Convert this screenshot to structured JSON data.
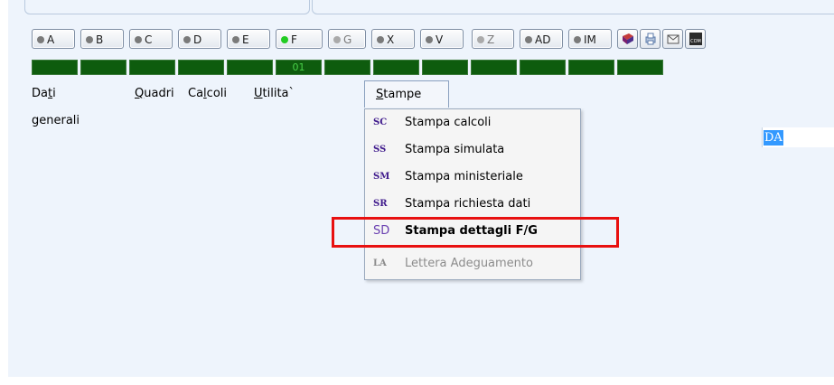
{
  "toolbar": {
    "buttons": [
      {
        "label": "A",
        "dot": "gray"
      },
      {
        "label": "B",
        "dot": "gray"
      },
      {
        "label": "C",
        "dot": "gray"
      },
      {
        "label": "D",
        "dot": "gray"
      },
      {
        "label": "E",
        "dot": "gray"
      },
      {
        "label": "F",
        "dot": "green"
      },
      {
        "label": "G",
        "dot": "lgray",
        "disabled": true
      },
      {
        "label": "X",
        "dot": "gray"
      },
      {
        "label": "V",
        "dot": "gray"
      },
      {
        "label": "Z",
        "dot": "lgray",
        "disabled": true
      },
      {
        "label": "AD",
        "dot": "gray"
      },
      {
        "label": "IM",
        "dot": "gray"
      }
    ],
    "icon_buttons": [
      "book-icon",
      "printer-icon",
      "envelope-icon",
      "com-icon"
    ],
    "icon_com_text": "COM"
  },
  "led_strip": {
    "values": [
      "",
      "",
      "",
      "",
      "",
      "01",
      "",
      "",
      "",
      "",
      "",
      "",
      ""
    ]
  },
  "menu": {
    "items": [
      {
        "pre": "Da",
        "acc": "t",
        "post": "i generali"
      },
      {
        "pre": "",
        "acc": "Q",
        "post": "uadri"
      },
      {
        "pre": "Ca",
        "acc": "l",
        "post": "coli"
      },
      {
        "pre": "",
        "acc": "U",
        "post": "tilita`"
      },
      {
        "pre": "",
        "acc": "S",
        "post": "tampe"
      }
    ],
    "open_index": 4
  },
  "dropdown": {
    "items": [
      {
        "icon": "SC",
        "label": "Stampa calcoli"
      },
      {
        "icon": "SS",
        "label": "Stampa simulata"
      },
      {
        "icon": "SM",
        "label": "Stampa ministeriale"
      },
      {
        "icon": "SR",
        "label": "Stampa richiesta dati"
      },
      {
        "icon": "SD",
        "label": "Stampa dettagli F/G",
        "bold": true,
        "highlighted": true
      },
      {
        "icon": "LA",
        "label": "Lettera Adeguamento",
        "disabled": true
      }
    ]
  },
  "field": {
    "selected_text": "DA"
  },
  "colors": {
    "highlight": "#e81010",
    "led_bg": "#0e5c0e",
    "selection": "#3399ff"
  }
}
